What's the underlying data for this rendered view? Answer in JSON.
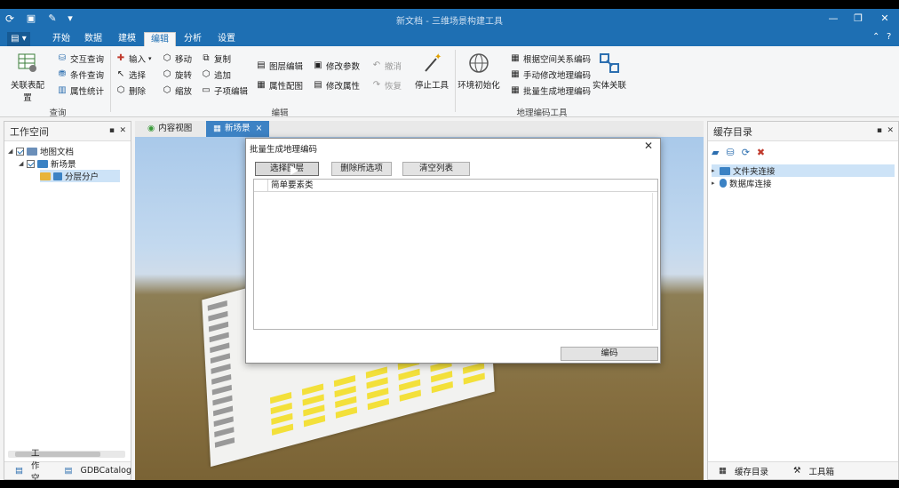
{
  "window": {
    "title": "新文档 - 三维场景构建工具"
  },
  "ribbon_tabs": [
    {
      "label": "开始"
    },
    {
      "label": "数据"
    },
    {
      "label": "建模"
    },
    {
      "label": "编辑"
    },
    {
      "label": "分析"
    },
    {
      "label": "设置"
    }
  ],
  "active_tab": "编辑",
  "ribbon": {
    "query": {
      "big_label": "关联表配置",
      "items": [
        "交互查询",
        "条件查询",
        "属性统计"
      ],
      "group_label": "查询"
    },
    "edit_small_col1": [
      "输入",
      "选择",
      "删除"
    ],
    "edit_small_col2": [
      "移动",
      "旋转",
      "缩放"
    ],
    "edit_small_col3": [
      "复制",
      "追加",
      "子项编辑"
    ],
    "edit_small_col4": [
      "图层编辑",
      "属性配图"
    ],
    "edit_small_col5": [
      "修改参数",
      "修改属性"
    ],
    "edit_group_label": "编辑",
    "undo_label": "撤消",
    "redo_label": "恢复",
    "stop_tool_label": "停止工具",
    "env_init_label": "环境初始化",
    "geo_items": [
      "根据空间关系编码",
      "手动修改地理编码",
      "批量生成地理编码"
    ],
    "geo_group_label": "地理编码工具",
    "entity_label": "实体关联"
  },
  "left_panel": {
    "title": "工作空间",
    "tree": [
      {
        "label": "地图文档",
        "checked": true
      },
      {
        "label": "新场景",
        "checked": true
      },
      {
        "label": "分层分户"
      }
    ],
    "footer_tabs": [
      "工作空间",
      "GDBCatalog"
    ]
  },
  "doc_tabs": [
    "内容视图",
    "新场景"
  ],
  "right_panel": {
    "title": "缓存目录",
    "tree": [
      "文件夹连接",
      "数据库连接"
    ],
    "footer_tabs": [
      "缓存目录",
      "工具箱"
    ]
  },
  "dialog": {
    "title": "批量生成地理编码",
    "buttons": {
      "select_layer": "选择图层",
      "delete_selected": "删除所选项",
      "clear_list": "清空列表",
      "encode": "编码"
    },
    "list_header": "简单要素类"
  },
  "colors": {
    "title_bar": "#1e6fb3",
    "accent": "#3d82c4",
    "building_window": "#f3e03a"
  }
}
